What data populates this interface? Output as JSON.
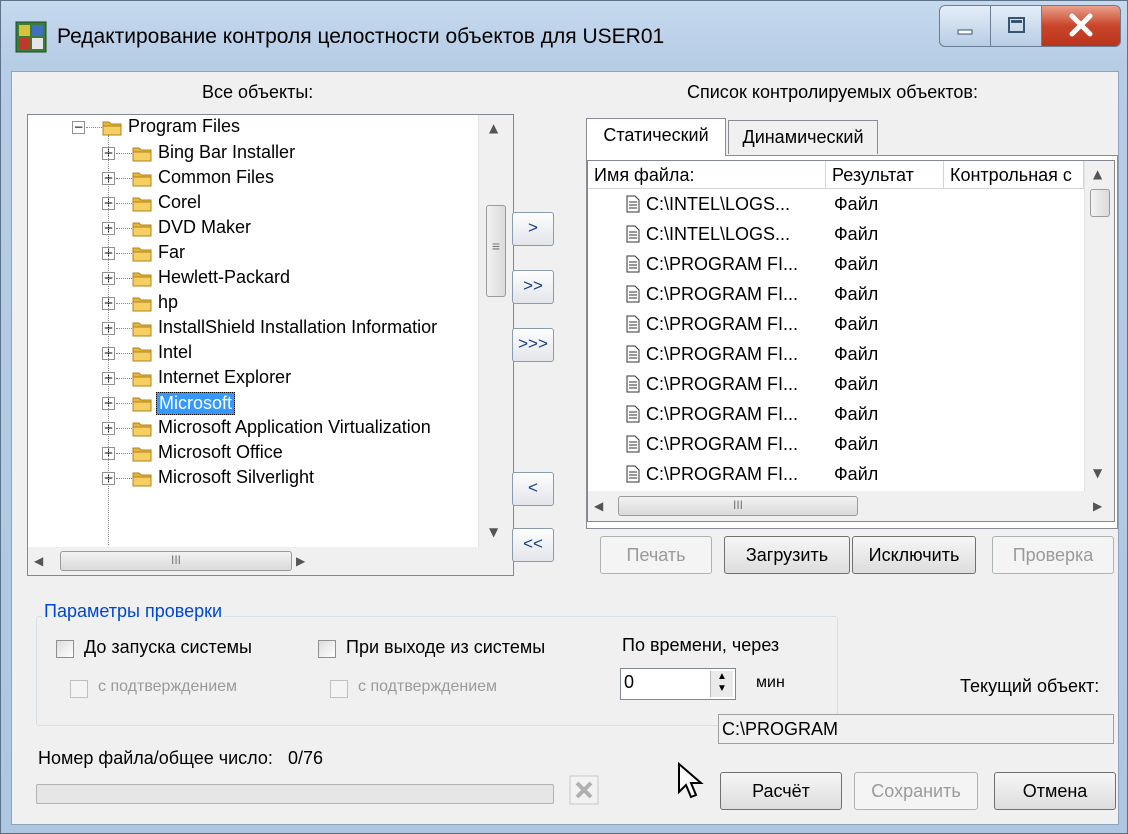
{
  "window": {
    "title": "Редактирование контроля целостности объектов для USER01"
  },
  "left": {
    "label": "Все объекты:",
    "root": "Program Files",
    "items": [
      "Bing Bar Installer",
      "Common Files",
      "Corel",
      "DVD Maker",
      "Far",
      "Hewlett-Packard",
      "hp",
      "InstallShield Installation Informatior",
      "Intel",
      "Internet Explorer",
      "Microsoft",
      "Microsoft Application Virtualization",
      "Microsoft Office",
      "Microsoft Silverlight"
    ],
    "selected_index": 10,
    "scroll_thumb_label": "≡"
  },
  "move_buttons": [
    ">",
    ">>",
    ">>>",
    "<",
    "<<"
  ],
  "right": {
    "label": "Список контролируемых объектов:",
    "tabs": [
      "Статический",
      "Динамический"
    ],
    "active_tab": 0,
    "columns": [
      "Имя файла:",
      "Результат",
      "Контрольная с"
    ],
    "rows": [
      {
        "name": "C:\\INTEL\\LOGS...",
        "result": "Файл"
      },
      {
        "name": "C:\\INTEL\\LOGS...",
        "result": "Файл"
      },
      {
        "name": "C:\\PROGRAM FI...",
        "result": "Файл"
      },
      {
        "name": "C:\\PROGRAM FI...",
        "result": "Файл"
      },
      {
        "name": "C:\\PROGRAM FI...",
        "result": "Файл"
      },
      {
        "name": "C:\\PROGRAM FI...",
        "result": "Файл"
      },
      {
        "name": "C:\\PROGRAM FI...",
        "result": "Файл"
      },
      {
        "name": "C:\\PROGRAM FI...",
        "result": "Файл"
      },
      {
        "name": "C:\\PROGRAM FI...",
        "result": "Файл"
      },
      {
        "name": "C:\\PROGRAM FI...",
        "result": "Файл"
      }
    ],
    "buttons": {
      "print": "Печать",
      "load": "Загрузить",
      "exclude": "Исключить",
      "check": "Проверка"
    }
  },
  "params": {
    "group_title": "Параметры проверки",
    "before_start": "До запуска системы",
    "on_exit": "При выходе из системы",
    "with_confirm_1": "с подтверждением",
    "with_confirm_2": "с подтверждением",
    "by_time": "По времени, через",
    "time_value": "0",
    "minutes": "мин"
  },
  "status": {
    "current_object_label": "Текущий объект:",
    "current_object_value": "C:\\PROGRAM",
    "file_counter_label": "Номер файла/общее число:",
    "file_counter_value": "0/76",
    "progress": 0
  },
  "bottom_buttons": {
    "calc": "Расчёт",
    "save": "Сохранить",
    "cancel": "Отмена"
  },
  "icons": {
    "app": "app-icon",
    "cancel_small": "cancel-x-icon",
    "cursor": "mouse-cursor-icon"
  }
}
